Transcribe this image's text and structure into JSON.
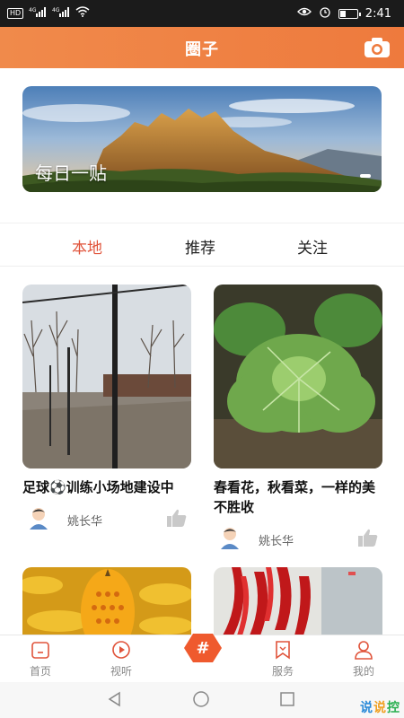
{
  "status_bar": {
    "hd": "HD",
    "sig1": "4G",
    "sig2": "4G",
    "time": "2:41",
    "battery_level": 0.35
  },
  "header": {
    "title": "圈子",
    "camera_icon": "camera-icon"
  },
  "banner": {
    "caption": "每日一贴"
  },
  "tabs": [
    {
      "label": "本地",
      "active": true
    },
    {
      "label": "推荐",
      "active": false
    },
    {
      "label": "关注",
      "active": false
    }
  ],
  "posts": [
    {
      "title": "足球⚽训练小场地建设中",
      "author": "姚长华"
    },
    {
      "title": "春看花，秋看菜，一样的美不胜收",
      "author": "姚长华"
    }
  ],
  "bottom_nav": [
    {
      "label": "首页",
      "icon": "home-icon"
    },
    {
      "label": "视听",
      "icon": "play-icon"
    },
    {
      "label": "#",
      "icon": "hashtag-icon"
    },
    {
      "label": "服务",
      "icon": "bookmark-icon"
    },
    {
      "label": "我的",
      "icon": "user-icon"
    }
  ],
  "watermark": {
    "c1": "说",
    "c2": "说",
    "c3": "控"
  },
  "colors": {
    "accent": "#ee7a3d",
    "active_tab": "#e0533a"
  }
}
